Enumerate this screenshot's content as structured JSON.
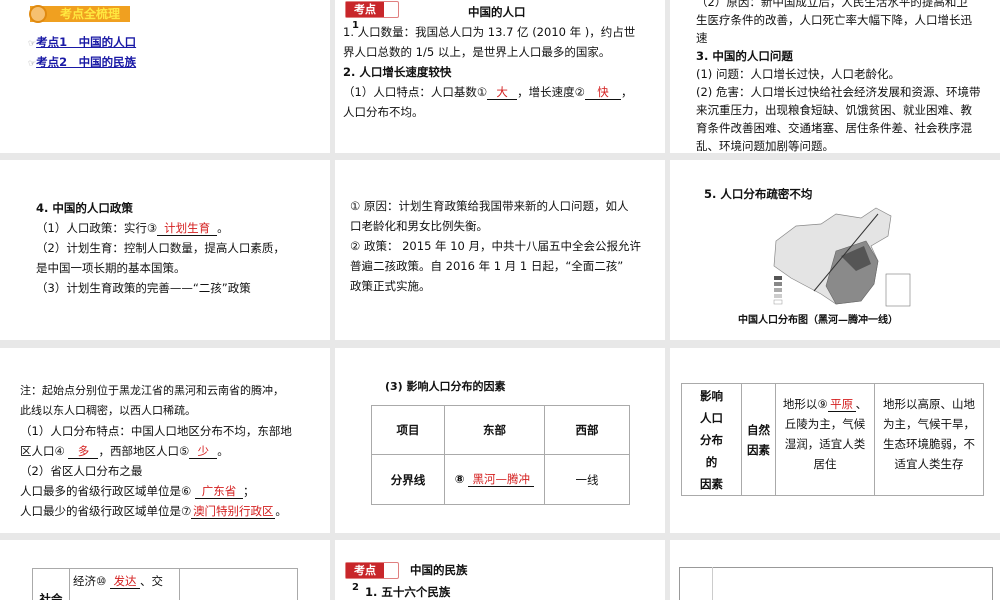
{
  "slide1": {
    "header": "考点全梳理",
    "links": [
      "考点1　中国的人口",
      "考点2　中国的民族"
    ]
  },
  "slide2": {
    "badge": "考点",
    "badge_num": "1",
    "title": "中国的人口",
    "l1": "1. 人口数量：我国总人口为 13.7 亿 (2010 年 )，约占世",
    "l2": "界人口总数的 1/5 以上，是世界上人口最多的国家。",
    "l3": "2. 人口增长速度较快",
    "l4a": "（1）人口特点：人口基数①",
    "a1": "大",
    "l4b": "，增长速度②",
    "a2": "快",
    "l4c": "，",
    "l5": "人口分布不均。"
  },
  "slide3": {
    "l1": "（2）原因：新中国成立后，人民生活水平的提高和卫",
    "l2": "生医疗条件的改善，人口死亡率大幅下降，人口增长迅",
    "l3": "速",
    "l4": "3. 中国的人口问题",
    "l5": "(1) 问题：人口增长过快，人口老龄化。",
    "l6": "(2) 危害：人口增长过快给社会经济发展和资源、环境带",
    "l7": "来沉重压力，出现粮食短缺、饥饿贫困、就业困难、教",
    "l8": "育条件改善困难、交通堵塞、居住条件差、社会秩序混",
    "l9": "乱、环境问题加剧等问题。"
  },
  "slide4": {
    "l1": "4. 中国的人口政策",
    "l2a": "（1）人口政策：实行③",
    "a3": "计划生育",
    "l2b": "。",
    "l3": "（2）计划生育：控制人口数量，提高人口素质，",
    "l4": "是中国一项长期的基本国策。",
    "l5": "（3）计划生育政策的完善——“二孩”政策"
  },
  "slide5": {
    "l1": "① 原因：计划生育政策给我国带来新的人口问题，如人",
    "l2": "口老龄化和男女比例失衡。",
    "l3": "② 政策： 2015 年 10 月，中共十八届五中全会公报允许",
    "l4": "普遍二孩政策。自 2016 年 1 月 1 日起，“全面二孩”",
    "l5": "政策正式实施。"
  },
  "slide6": {
    "title": "5. 人口分布疏密不均",
    "caption": "中国人口分布图（黑河—腾冲一线）"
  },
  "slide7": {
    "l1": "注：起始点分别位于黑龙江省的黑河和云南省的腾冲，",
    "l2": "此线以东人口稠密，以西人口稀疏。",
    "l3": "（1）人口分布特点：中国人口地区分布不均，东部地",
    "l4a": "区人口④",
    "a4": "多",
    "l4b": "，西部地区人口⑤",
    "a5": "少",
    "l4c": "。",
    "l5": "（2）省区人口分布之最",
    "l6a": "人口最多的省级行政区域单位是⑥",
    "a6": "广东省",
    "l6b": "；",
    "l7a": "人口最少的省级行政区域单位是⑦",
    "a7": "澳门特别行政区",
    "l7b": "。"
  },
  "slide8": {
    "title": "(3) 影响人口分布的因素",
    "headers": [
      "项目",
      "东部",
      "西部"
    ],
    "row_label": "分界线",
    "row_prefix": "⑧",
    "a8": "黑河—腾冲",
    "row_west": "一线"
  },
  "slide9": {
    "c1": [
      "影响",
      "人口",
      "分布",
      "的",
      "因素"
    ],
    "c2": [
      "自然",
      "因素"
    ],
    "c3a": "地形以⑨",
    "a9": "平原",
    "c3b": "、",
    "c3c": [
      "丘陵为主，气候",
      "湿润，适宜人类",
      "居住"
    ],
    "c4": [
      "地形以高原、山地",
      "为主，气候干旱，",
      "生态环境脆弱，不",
      "适宜人类生存"
    ]
  },
  "slide10": {
    "label": "社会",
    "c2a": "经济⑩",
    "a10": "发达",
    "c2b": "、交"
  },
  "slide11": {
    "badge": "考点",
    "badge_num": "2",
    "title": "中国的民族",
    "l1": "1. 五十六个民族"
  }
}
